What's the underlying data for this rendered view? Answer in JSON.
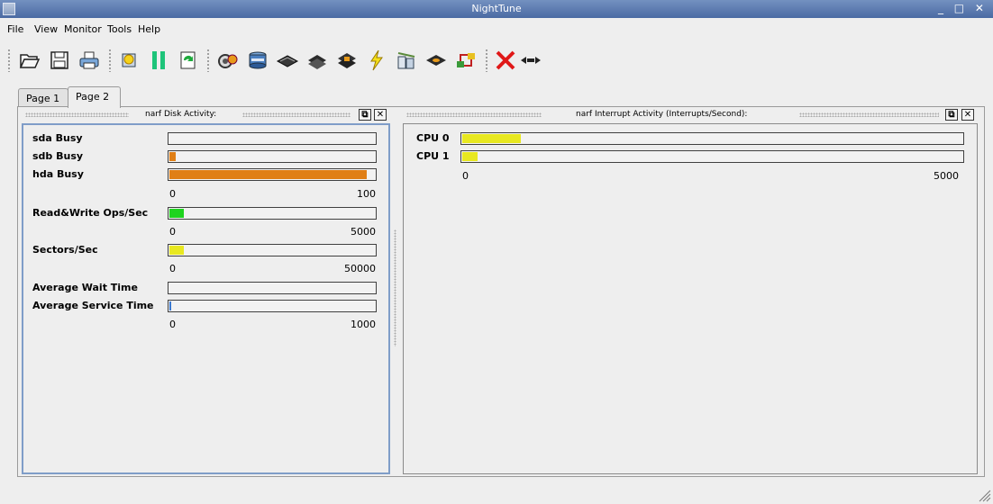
{
  "window": {
    "title": "NightTune",
    "controls": "_ □ ✕"
  },
  "menu": [
    "File",
    "View",
    "Monitor",
    "Tools",
    "Help"
  ],
  "toolbar": {
    "buttons": [
      "open-icon",
      "save-icon",
      "print-icon",
      "new-panel-icon",
      "pause-icon",
      "refresh-icon",
      "cpu-settings-icon",
      "disk-icon",
      "memory-icon",
      "processor-icon",
      "chip-icon",
      "interrupt-icon",
      "network-icon",
      "device-icon",
      "network-panel-icon",
      "close-icon",
      "expand-icon"
    ]
  },
  "tabs": [
    {
      "label": "Page 1",
      "active": false
    },
    {
      "label": "Page 2",
      "active": true
    }
  ],
  "disk_panel": {
    "title": "narf Disk Activity:",
    "rows": [
      {
        "label": "sda Busy",
        "value": 0,
        "max": 100,
        "color": "#e07f16"
      },
      {
        "label": "sdb Busy",
        "value": 3,
        "max": 100,
        "color": "#e07f16"
      },
      {
        "label": "hda Busy",
        "value": 96,
        "max": 100,
        "color": "#e07f16"
      },
      {
        "label": "Read&Write Ops/Sec",
        "value": 340,
        "max": 5000,
        "color": "#1fd41f"
      },
      {
        "label": "Sectors/Sec",
        "value": 3500,
        "max": 50000,
        "color": "#e8e820"
      },
      {
        "label": "Average Wait Time",
        "value": 0,
        "max": 1000,
        "color": "#3a78d0"
      },
      {
        "label": "Average Service Time",
        "value": 8,
        "max": 1000,
        "color": "#3a78d0"
      }
    ],
    "scales": [
      {
        "min": "0",
        "max": "100"
      },
      {
        "min": "0",
        "max": "5000"
      },
      {
        "min": "0",
        "max": "50000"
      },
      {
        "min": "0",
        "max": "1000"
      }
    ]
  },
  "irq_panel": {
    "title": "narf Interrupt Activity (Interrupts/Second):",
    "rows": [
      {
        "label": "CPU 0",
        "value": 590,
        "max": 5000,
        "color": "#e8e820"
      },
      {
        "label": "CPU 1",
        "value": 150,
        "max": 5000,
        "color": "#e8e820"
      }
    ],
    "scale": {
      "min": "0",
      "max": "5000"
    }
  },
  "panel_buttons": {
    "float": "⧉",
    "close": "✕"
  }
}
